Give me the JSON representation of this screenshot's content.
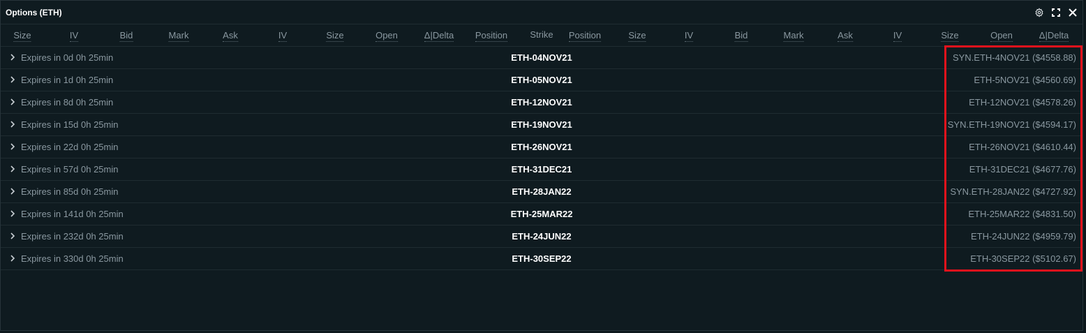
{
  "window": {
    "title": "Options (ETH)",
    "icons": [
      "gear-icon",
      "expand-icon",
      "close-icon"
    ]
  },
  "columns": {
    "calls": [
      "Size",
      "IV",
      "Bid",
      "Mark",
      "Ask",
      "IV",
      "Size",
      "Open",
      "Δ|Delta",
      "Position"
    ],
    "strike": "Strike",
    "puts": [
      "Position",
      "Size",
      "IV",
      "Bid",
      "Mark",
      "Ask",
      "IV",
      "Size",
      "Open",
      "Δ|Delta"
    ]
  },
  "rows": [
    {
      "expires": "Expires in 0d 0h 25min",
      "expiry": "ETH-04NOV21",
      "underlying": "SYN.ETH-4NOV21 ($4558.88)"
    },
    {
      "expires": "Expires in 1d 0h 25min",
      "expiry": "ETH-05NOV21",
      "underlying": "ETH-5NOV21 ($4560.69)"
    },
    {
      "expires": "Expires in 8d 0h 25min",
      "expiry": "ETH-12NOV21",
      "underlying": "ETH-12NOV21 ($4578.26)"
    },
    {
      "expires": "Expires in 15d 0h 25min",
      "expiry": "ETH-19NOV21",
      "underlying": "SYN.ETH-19NOV21 ($4594.17)"
    },
    {
      "expires": "Expires in 22d 0h 25min",
      "expiry": "ETH-26NOV21",
      "underlying": "ETH-26NOV21 ($4610.44)"
    },
    {
      "expires": "Expires in 57d 0h 25min",
      "expiry": "ETH-31DEC21",
      "underlying": "ETH-31DEC21 ($4677.76)"
    },
    {
      "expires": "Expires in 85d 0h 25min",
      "expiry": "ETH-28JAN22",
      "underlying": "SYN.ETH-28JAN22 ($4727.92)"
    },
    {
      "expires": "Expires in 141d 0h 25min",
      "expiry": "ETH-25MAR22",
      "underlying": "ETH-25MAR22 ($4831.50)"
    },
    {
      "expires": "Expires in 232d 0h 25min",
      "expiry": "ETH-24JUN22",
      "underlying": "ETH-24JUN22 ($4959.79)"
    },
    {
      "expires": "Expires in 330d 0h 25min",
      "expiry": "ETH-30SEP22",
      "underlying": "ETH-30SEP22 ($5102.67)"
    }
  ],
  "colors": {
    "background": "#0f1b20",
    "text_muted": "#8a98a0",
    "text_strong": "#ffffff",
    "highlight": "#e8121c"
  }
}
